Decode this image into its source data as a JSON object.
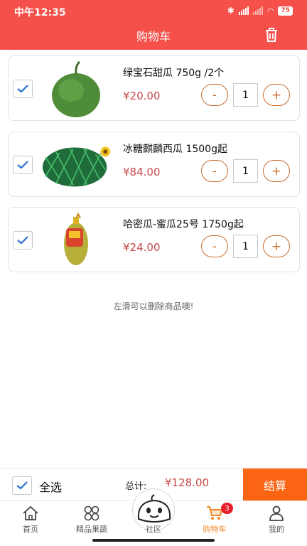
{
  "status": {
    "time": "中午12:35",
    "battery": "75"
  },
  "header": {
    "title": "购物车"
  },
  "cart": {
    "items": [
      {
        "name": "绿宝石甜瓜 750g /2个",
        "price": "¥20.00",
        "quantity": "1",
        "minus": "-",
        "plus": "+"
      },
      {
        "name": "冰糖麒麟西瓜 1500g起",
        "price": "¥84.00",
        "quantity": "1",
        "minus": "-",
        "plus": "+"
      },
      {
        "name": "哈密瓜-蜜瓜25号 1750g起",
        "price": "¥24.00",
        "quantity": "1",
        "minus": "-",
        "plus": "+"
      }
    ],
    "hint": "左滑可以删除商品噢!"
  },
  "footer": {
    "select_all": "全选",
    "total_label": "总计:",
    "total_value": "¥128.00",
    "checkout": "结算"
  },
  "tabs": [
    {
      "label": "首页",
      "icon": "home-icon"
    },
    {
      "label": "精品果蔬",
      "icon": "grid-icon"
    },
    {
      "label": "社区",
      "icon": "community-icon"
    },
    {
      "label": "购物车",
      "icon": "cart-icon",
      "badge": "3",
      "active": true
    },
    {
      "label": "我的",
      "icon": "user-icon"
    }
  ],
  "colors": {
    "primary": "#f5504a",
    "accent": "#fb6412",
    "price": "#c74a48",
    "stepper": "#c86c2e",
    "check": "#2a6fd1"
  }
}
